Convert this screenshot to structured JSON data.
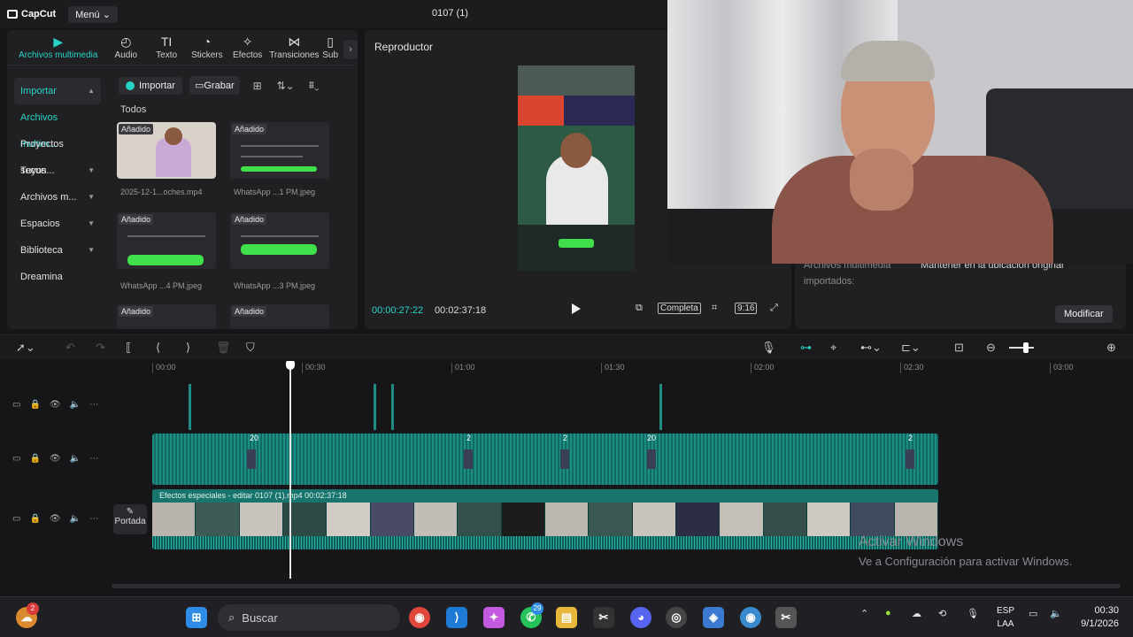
{
  "app": {
    "logo": "CapCut",
    "menu_label": "Menú",
    "doc_title": "0107 (1)"
  },
  "tabs": [
    {
      "label": "Archivos multimedia",
      "icon": "media-icon",
      "glyph": "▶"
    },
    {
      "label": "Audio",
      "icon": "audio-icon",
      "glyph": "◴"
    },
    {
      "label": "Texto",
      "icon": "text-icon",
      "glyph": "TI"
    },
    {
      "label": "Stickers",
      "icon": "sticker-icon",
      "glyph": "◔"
    },
    {
      "label": "Efectos",
      "icon": "effects-icon",
      "glyph": "✧"
    },
    {
      "label": "Transiciones",
      "icon": "transitions-icon",
      "glyph": "⋈"
    },
    {
      "label": "Sub",
      "icon": "subtitles-icon",
      "glyph": "▯"
    }
  ],
  "sidebar": {
    "items": [
      {
        "label": "Importar",
        "chevron": "▲"
      },
      {
        "label": "Archivos multim...",
        "chevron": ""
      },
      {
        "label": "Proyectos secun...",
        "chevron": ""
      },
      {
        "label": "Tuyos",
        "chevron": "▼"
      },
      {
        "label": "Archivos m...",
        "chevron": "▼"
      },
      {
        "label": "Espacios",
        "chevron": "▼"
      },
      {
        "label": "Biblioteca",
        "chevron": "▼"
      },
      {
        "label": "Dreamina",
        "chevron": ""
      }
    ]
  },
  "media": {
    "import_label": "Importar",
    "record_label": "Grabar",
    "section_label": "Todos",
    "added_badge": "Añadido",
    "files": [
      "2025-12-1...oches.mp4",
      "WhatsApp ...1 PM.jpeg",
      "WhatsApp ...4 PM.jpeg",
      "WhatsApp ...3 PM.jpeg"
    ]
  },
  "player": {
    "title": "Reproductor",
    "current_time": "00:00:27:22",
    "total_time": "00:02:37:18",
    "quality": "Completa",
    "ratio": "9:16"
  },
  "details": {
    "key1": "Archivos multimedia",
    "value1": "Mantener en la ubicación original",
    "key2": "importados:",
    "modify_label": "Modificar"
  },
  "timeline": {
    "ruler": [
      "00:00",
      "00:30",
      "01:00",
      "01:30",
      "02:00",
      "02:30",
      "03:00"
    ],
    "markers": [
      "20",
      "2",
      "2",
      "20",
      "2"
    ],
    "video_clip_label": "Efectos especiales - editar   0107 (1).mp4   00:02:37:18",
    "cover_label": "Portada"
  },
  "watermark": {
    "line1": "Activar Windows",
    "line2": "Ve a Configuración para activar Windows."
  },
  "taskbar": {
    "search_placeholder": "Buscar",
    "whatsapp_badge": "29",
    "weather_badge": "2",
    "lang": "ESP",
    "lang2": "LAA",
    "time": "00:30",
    "date": "9/1/2026"
  },
  "colors": {
    "accent": "#27d3c6",
    "clip": "#1b8f86",
    "green_bar": "#3fe04a"
  }
}
